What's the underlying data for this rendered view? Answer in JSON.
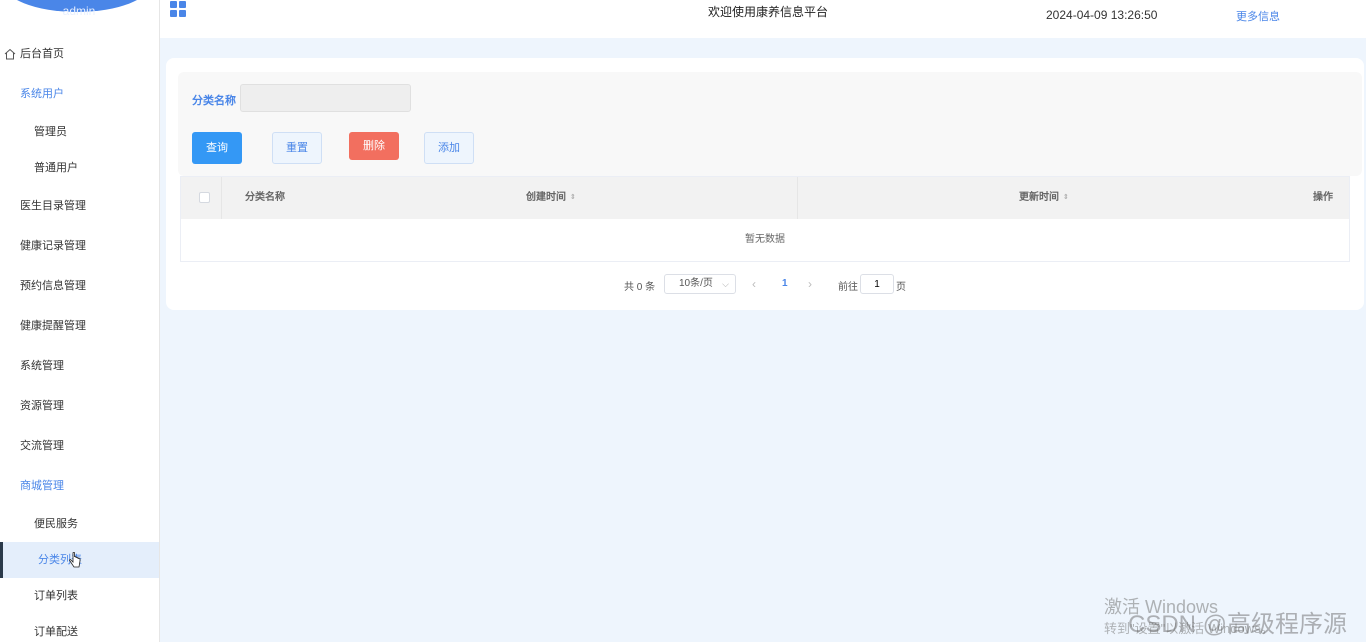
{
  "sidebar": {
    "user": "admin",
    "items": [
      {
        "label": "后台首页"
      },
      {
        "label": "系统用户"
      },
      {
        "label": "管理员"
      },
      {
        "label": "普通用户"
      },
      {
        "label": "医生目录管理"
      },
      {
        "label": "健康记录管理"
      },
      {
        "label": "预约信息管理"
      },
      {
        "label": "健康提醒管理"
      },
      {
        "label": "系统管理"
      },
      {
        "label": "资源管理"
      },
      {
        "label": "交流管理"
      },
      {
        "label": "商城管理"
      },
      {
        "label": "便民服务"
      },
      {
        "label": "分类列表"
      },
      {
        "label": "订单列表"
      },
      {
        "label": "订单配送"
      }
    ]
  },
  "header": {
    "title": "欢迎使用康养信息平台",
    "datetime": "2024-04-09 13:26:50",
    "more_link": "更多信息"
  },
  "search": {
    "label": "分类名称",
    "value": "",
    "buttons": {
      "query": "查询",
      "reset": "重置",
      "delete": "删除",
      "add": "添加"
    }
  },
  "table": {
    "columns": [
      "分类名称",
      "创建时间",
      "更新时间",
      "操作"
    ],
    "sort_icon": "⇕",
    "empty_text": "暂无数据"
  },
  "pagination": {
    "total": "共 0 条",
    "page_size": "10条/页",
    "current_page": "1",
    "goto_label": "前往",
    "goto_value": "1",
    "page_unit": "页"
  },
  "watermark": {
    "line1": "激活 Windows",
    "line2": "转到\"设置\"以激活 Windows。",
    "csdn": "CSDN @高级程序源"
  },
  "colors": {
    "accent": "#4a86e8",
    "primary_button": "#3498f5",
    "danger_button": "#f26f5f",
    "background": "#eef5fd"
  }
}
